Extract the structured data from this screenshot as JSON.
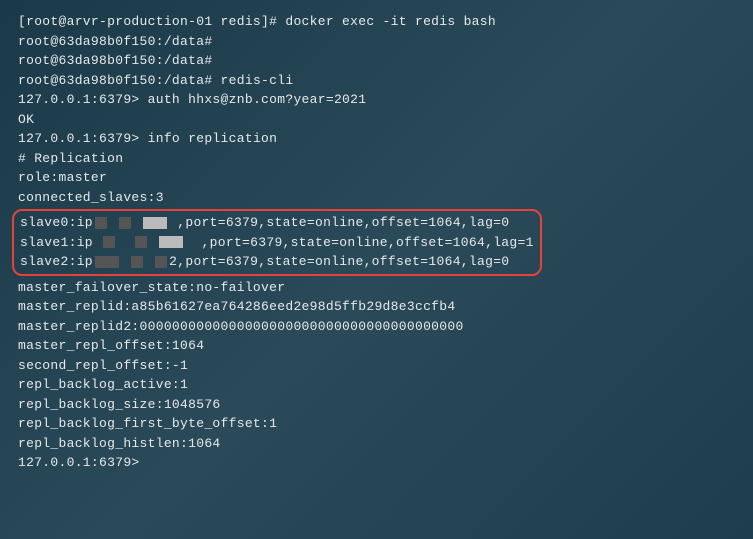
{
  "lines": {
    "l1_prompt": "[root@arvr-production-01 redis]# ",
    "l1_cmd": "docker exec -it redis bash",
    "l2": "root@63da98b0f150:/data#",
    "l3": "root@63da98b0f150:/data#",
    "l4_prompt": "root@63da98b0f150:/data# ",
    "l4_cmd": "redis-cli",
    "l5_prompt": "127.0.0.1:6379> ",
    "l5_cmd": "auth hhxs@znb.com?year=2021",
    "l6": "OK",
    "l7_prompt": "127.0.0.1:6379> ",
    "l7_cmd": "info replication",
    "l8": "# Replication",
    "l9": "role:master",
    "l10": "connected_slaves:3",
    "slave0_pre": "slave0:ip",
    "slave0_post": ",port=6379,state=online,offset=1064,lag=0",
    "slave1_pre": "slave1:ip",
    "slave1_post": ",port=6379,state=online,offset=1064,lag=1",
    "slave2_pre": "slave2:ip",
    "slave2_mid": "2",
    "slave2_post": ",port=6379,state=online,offset=1064,lag=0",
    "l14": "master_failover_state:no-failover",
    "l15": "master_replid:a85b61627ea764286eed2e98d5ffb29d8e3ccfb4",
    "l16": "master_replid2:0000000000000000000000000000000000000000",
    "l17": "master_repl_offset:1064",
    "l18": "second_repl_offset:-1",
    "l19": "repl_backlog_active:1",
    "l20": "repl_backlog_size:1048576",
    "l21": "repl_backlog_first_byte_offset:1",
    "l22": "repl_backlog_histlen:1064",
    "l23": "127.0.0.1:6379>"
  }
}
